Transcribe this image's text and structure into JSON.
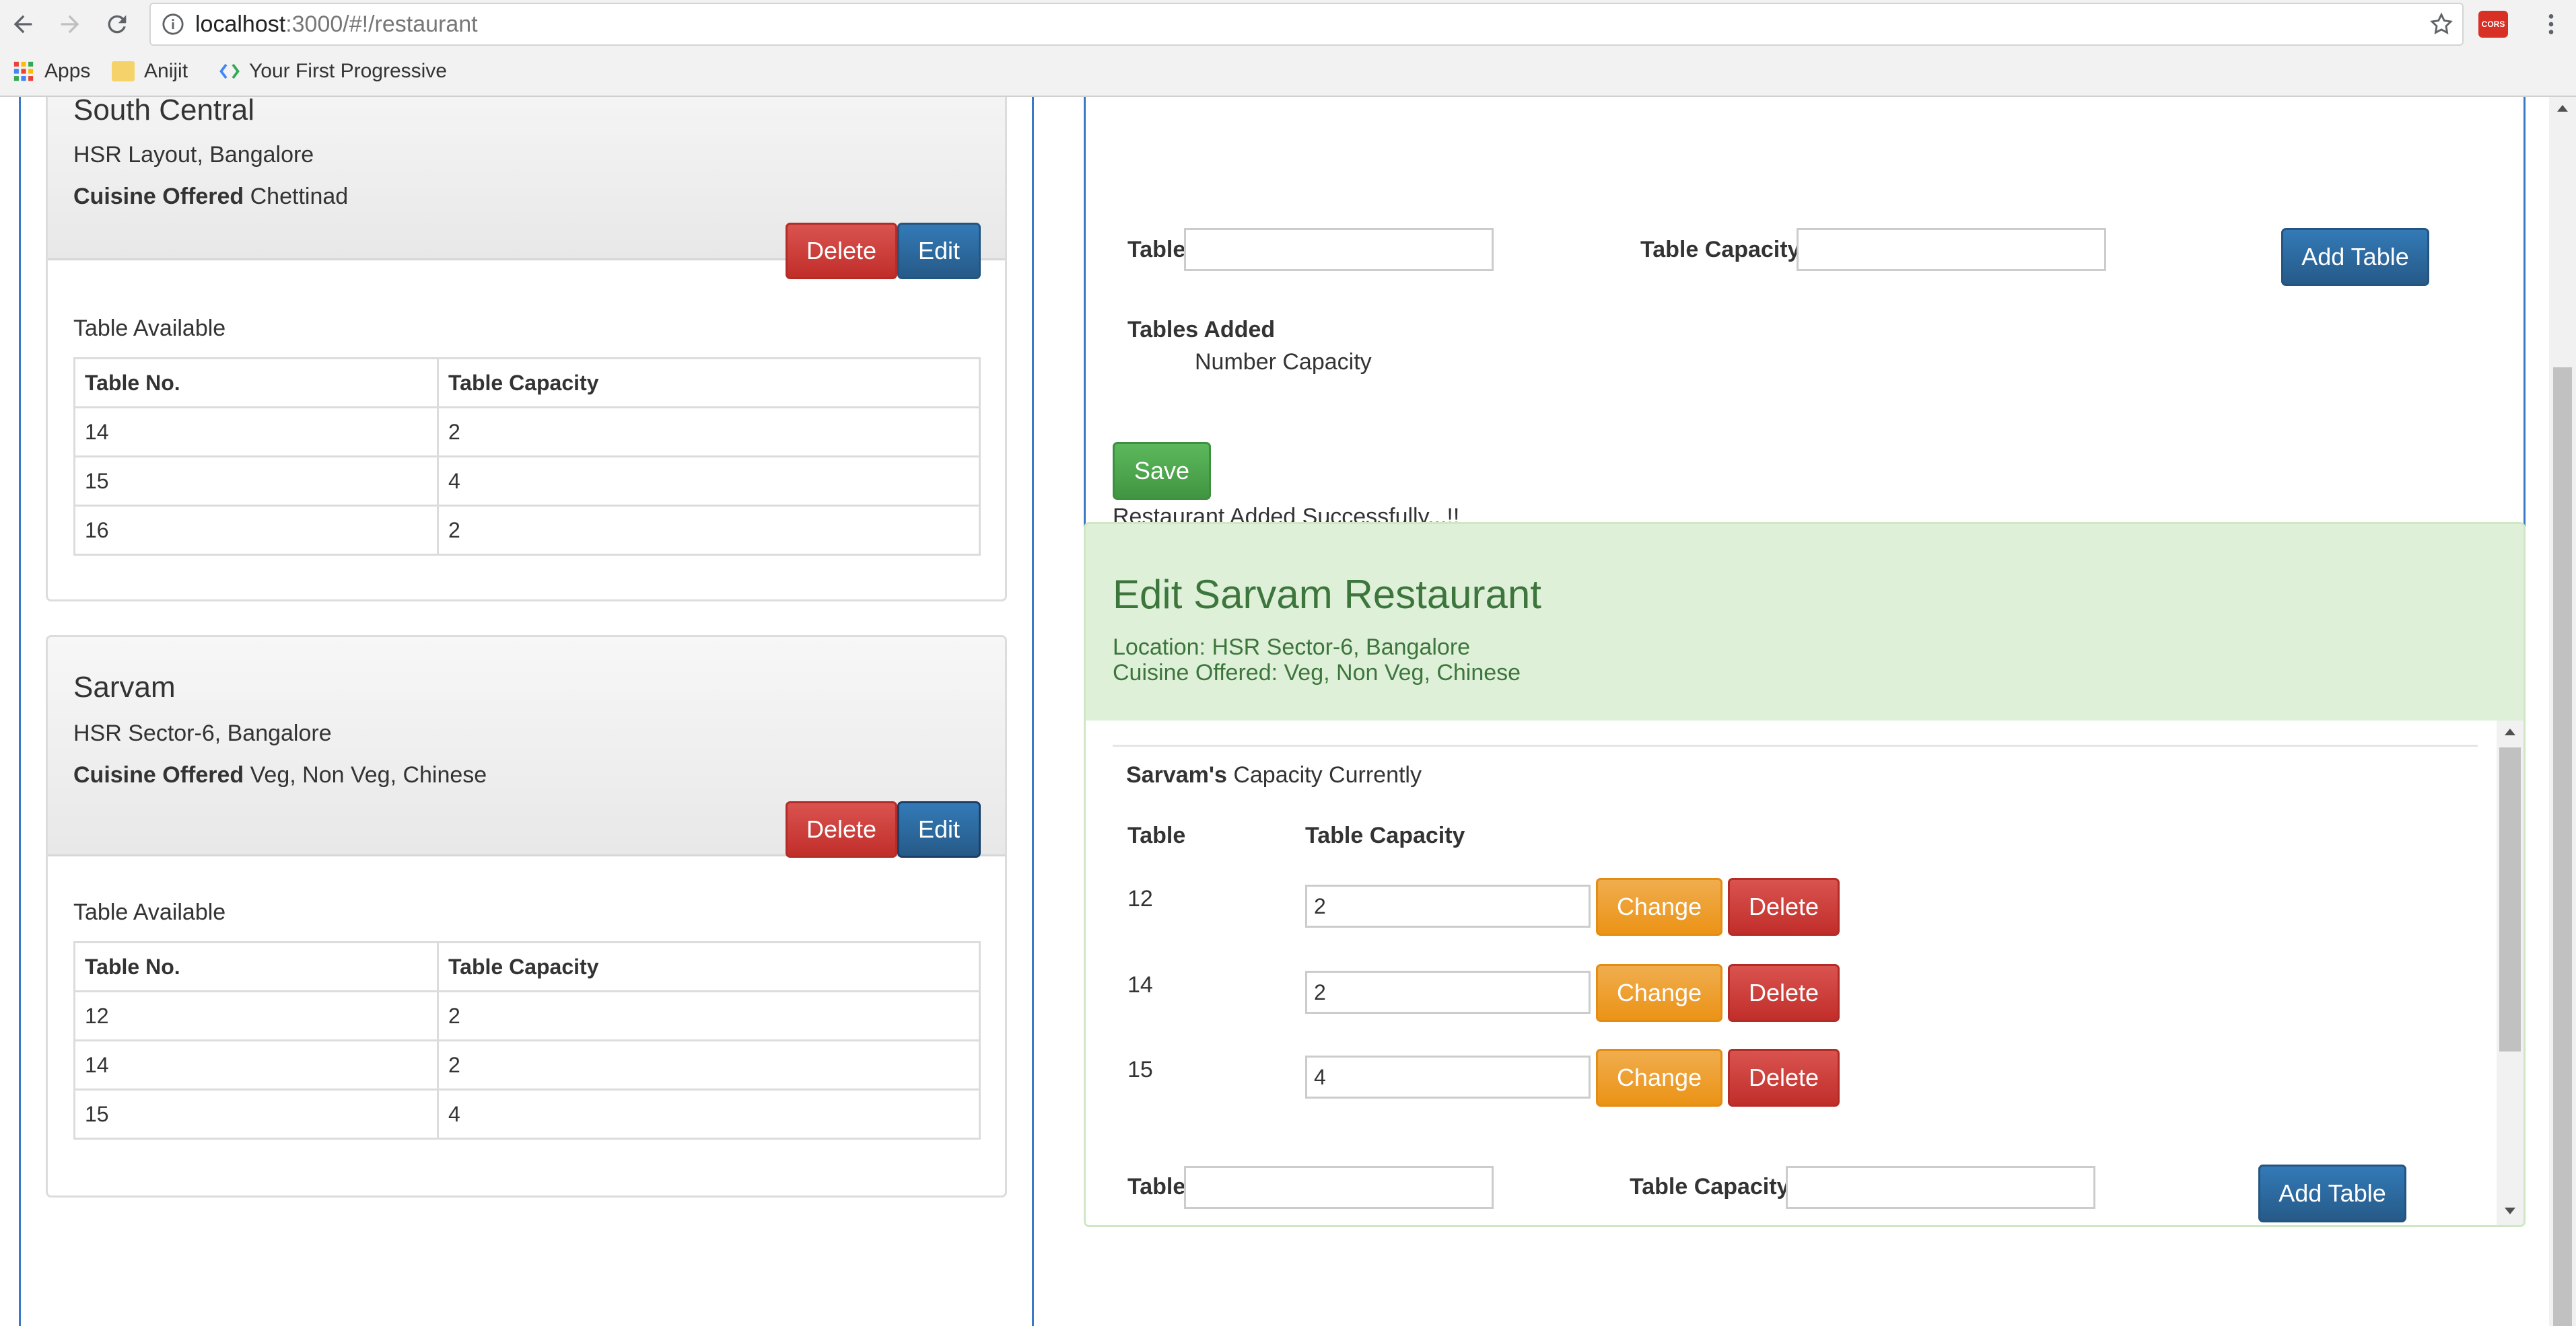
{
  "browser": {
    "url_host": "localhost",
    "url_path": ":3000/#!/restaurant",
    "ext_badge": "CORS",
    "bookmarks": [
      "Apps",
      "Anijit",
      "Your First Progressive"
    ]
  },
  "left": {
    "restaurants": [
      {
        "name": "South Central",
        "location": "HSR Layout, Bangalore",
        "cuisine_label": "Cuisine Offered",
        "cuisine": "Chettinad",
        "delete_label": "Delete",
        "edit_label": "Edit",
        "table_available_label": "Table Available",
        "columns": [
          "Table No.",
          "Table Capacity"
        ],
        "rows": [
          [
            "14",
            "2"
          ],
          [
            "15",
            "4"
          ],
          [
            "16",
            "2"
          ]
        ]
      },
      {
        "name": "Sarvam",
        "location": "HSR Sector-6, Bangalore",
        "cuisine_label": "Cuisine Offered",
        "cuisine": "Veg, Non Veg, Chinese",
        "delete_label": "Delete",
        "edit_label": "Edit",
        "table_available_label": "Table Available",
        "columns": [
          "Table No.",
          "Table Capacity"
        ],
        "rows": [
          [
            "12",
            "2"
          ],
          [
            "14",
            "2"
          ],
          [
            "15",
            "4"
          ]
        ]
      }
    ]
  },
  "add_form": {
    "table_label": "Table",
    "table_value": "",
    "capacity_label": "Table Capacity",
    "capacity_value": "",
    "add_table_label": "Add Table",
    "tables_added_label": "Tables Added",
    "tables_added_header": "Number Capacity",
    "save_label": "Save",
    "status": "Restaurant Added Successfully...!!"
  },
  "edit_panel": {
    "title": "Edit Sarvam Restaurant",
    "location": "Location: HSR Sector-6, Bangalore",
    "cuisine": "Cuisine Offered: Veg, Non Veg, Chinese",
    "capacity_owner": "Sarvam's",
    "capacity_suffix": "Capacity Currently",
    "col_table": "Table",
    "col_capacity": "Table Capacity",
    "rows": [
      {
        "table": "12",
        "capacity": "2"
      },
      {
        "table": "14",
        "capacity": "2"
      },
      {
        "table": "15",
        "capacity": "4"
      }
    ],
    "change_label": "Change",
    "delete_label": "Delete",
    "table_label": "Table",
    "capacity_label": "Table Capacity",
    "add_table_label": "Add Table"
  },
  "colors": {
    "danger": "#d9534f",
    "primary": "#337ab7",
    "success": "#5cb85c",
    "warning": "#f0ad4e",
    "edit_header_bg": "#dff0d8",
    "edit_header_text": "#3c763d",
    "column_divider": "#3a79c6"
  }
}
